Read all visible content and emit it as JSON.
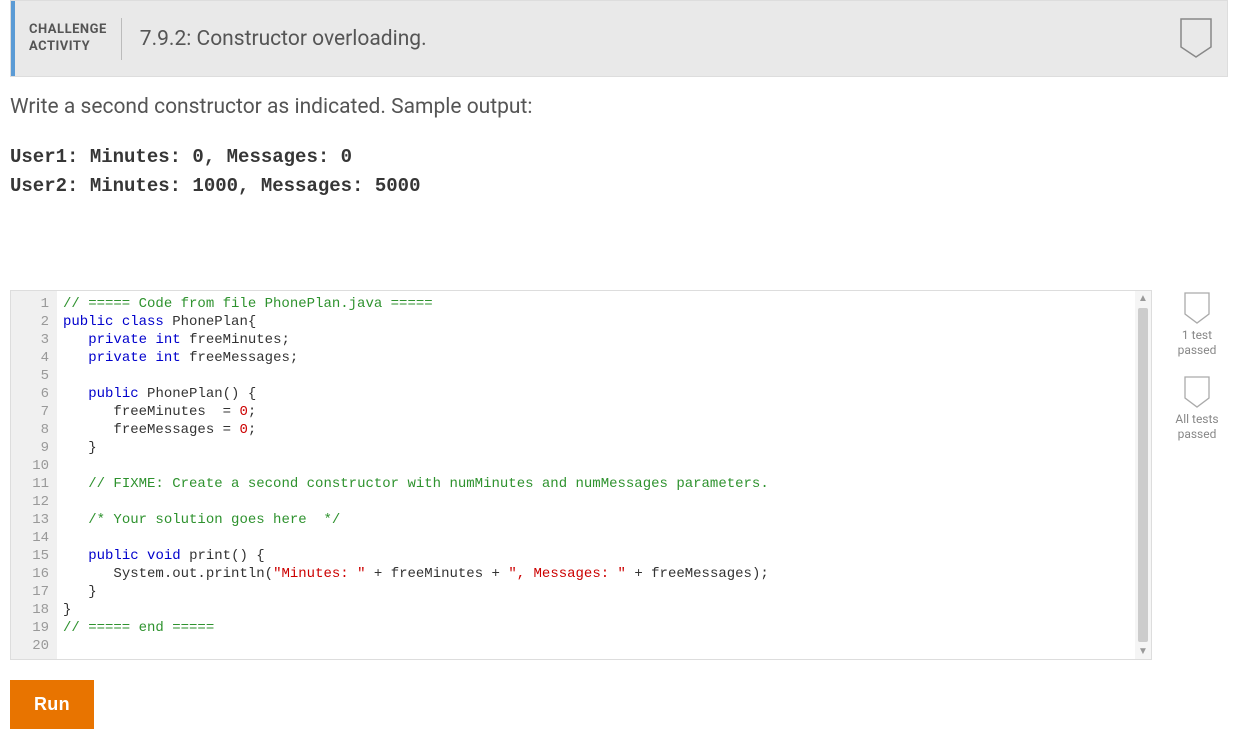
{
  "header": {
    "badge_line1": "CHALLENGE",
    "badge_line2": "ACTIVITY",
    "title": "7.9.2: Constructor overloading."
  },
  "instructions": {
    "text": "Write a second constructor as indicated. Sample output:",
    "sample_output": "User1: Minutes: 0, Messages: 0\nUser2: Minutes: 1000, Messages: 5000"
  },
  "editor": {
    "line_count": 20,
    "highlighted_lines": [
      1,
      2,
      3,
      4,
      5,
      6,
      7,
      8,
      9,
      10,
      11,
      15,
      16,
      17,
      18,
      19,
      20
    ],
    "code": {
      "l1": {
        "comment": "// ===== Code from file PhonePlan.java ====="
      },
      "l2": {
        "kw1": "public",
        "kw2": "class",
        "name": "PhonePlan",
        "brace": "{"
      },
      "l3": {
        "indent": "   ",
        "kw1": "private",
        "kw2": "int",
        "name": "freeMinutes;"
      },
      "l4": {
        "indent": "   ",
        "kw1": "private",
        "kw2": "int",
        "name": "freeMessages;"
      },
      "l5": {
        "blank": ""
      },
      "l6": {
        "indent": "   ",
        "kw1": "public",
        "name": "PhonePlan() {"
      },
      "l7": {
        "indent": "      ",
        "name": "freeMinutes  = ",
        "num": "0",
        "semi": ";"
      },
      "l8": {
        "indent": "      ",
        "name": "freeMessages = ",
        "num": "0",
        "semi": ";"
      },
      "l9": {
        "indent": "   ",
        "brace": "}"
      },
      "l10": {
        "blank": ""
      },
      "l11": {
        "indent": "   ",
        "comment": "// FIXME: Create a second constructor with numMinutes and numMessages parameters."
      },
      "l12": {
        "blank": ""
      },
      "l13": {
        "indent": "   ",
        "comment": "/* Your solution goes here  */"
      },
      "l14": {
        "blank": ""
      },
      "l15": {
        "indent": "   ",
        "kw1": "public",
        "kw2": "void",
        "name": "print() {"
      },
      "l16": {
        "indent": "      ",
        "call": "System.out.println(",
        "str1": "\"Minutes: \"",
        "plus1": " + freeMinutes + ",
        "str2": "\", Messages: \"",
        "plus2": " + freeMessages);"
      },
      "l17": {
        "indent": "   ",
        "brace": "}"
      },
      "l18": {
        "brace": "}"
      },
      "l19": {
        "comment": "// ===== end ====="
      },
      "l20": {
        "blank": ""
      }
    }
  },
  "status": {
    "item1_line1": "1 test",
    "item1_line2": "passed",
    "item2_line1": "All tests",
    "item2_line2": "passed"
  },
  "buttons": {
    "run": "Run"
  }
}
